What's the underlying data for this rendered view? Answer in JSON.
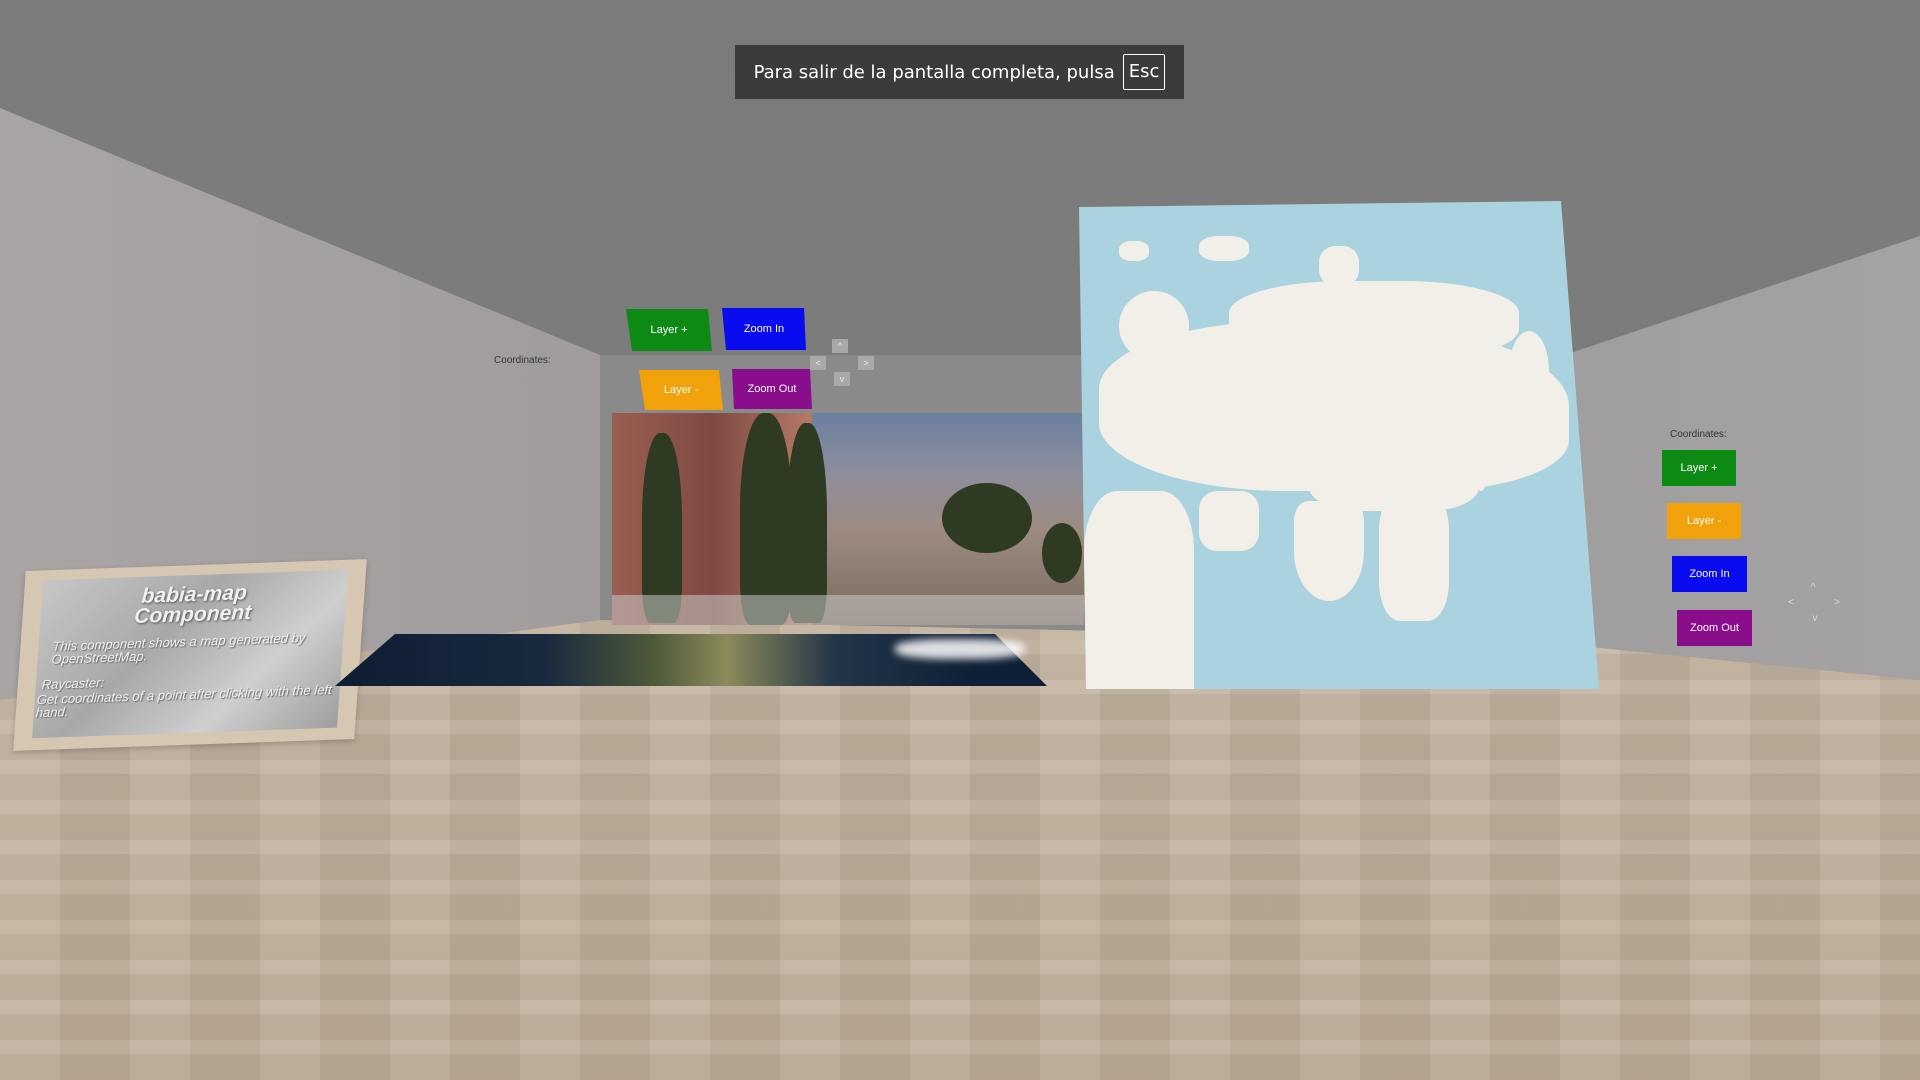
{
  "fullscreen_notice": {
    "message": "Para salir de la pantalla completa, pulsa",
    "key": "Esc"
  },
  "info_panel": {
    "title_line1": "babia-map",
    "title_line2": "Component",
    "description": "This component shows a map generated by OpenStreetMap.",
    "raycaster_title": "Raycaster:",
    "raycaster_text": "Get coordinates of a point after clicking with the left hand."
  },
  "left_controls": {
    "coordinates_label": "Coordinates:",
    "layer_plus": "Layer +",
    "layer_minus": "Layer -",
    "zoom_in": "Zoom In",
    "zoom_out": "Zoom Out",
    "arrow_up": "^",
    "arrow_down": "v",
    "arrow_left": "<",
    "arrow_right": ">"
  },
  "right_controls": {
    "coordinates_label": "Coordinates:",
    "layer_plus": "Layer +",
    "layer_minus": "Layer -",
    "zoom_in": "Zoom In",
    "zoom_out": "Zoom Out",
    "arrow_up": "^",
    "arrow_down": "v",
    "arrow_left": "<",
    "arrow_right": ">"
  },
  "colors": {
    "layer_plus": "#0d8a13",
    "layer_minus": "#f1a10a",
    "zoom_in": "#0a0cf0",
    "zoom_out": "#8a0d8c",
    "map_water": "#aad3df",
    "map_land": "#f2efe9"
  }
}
